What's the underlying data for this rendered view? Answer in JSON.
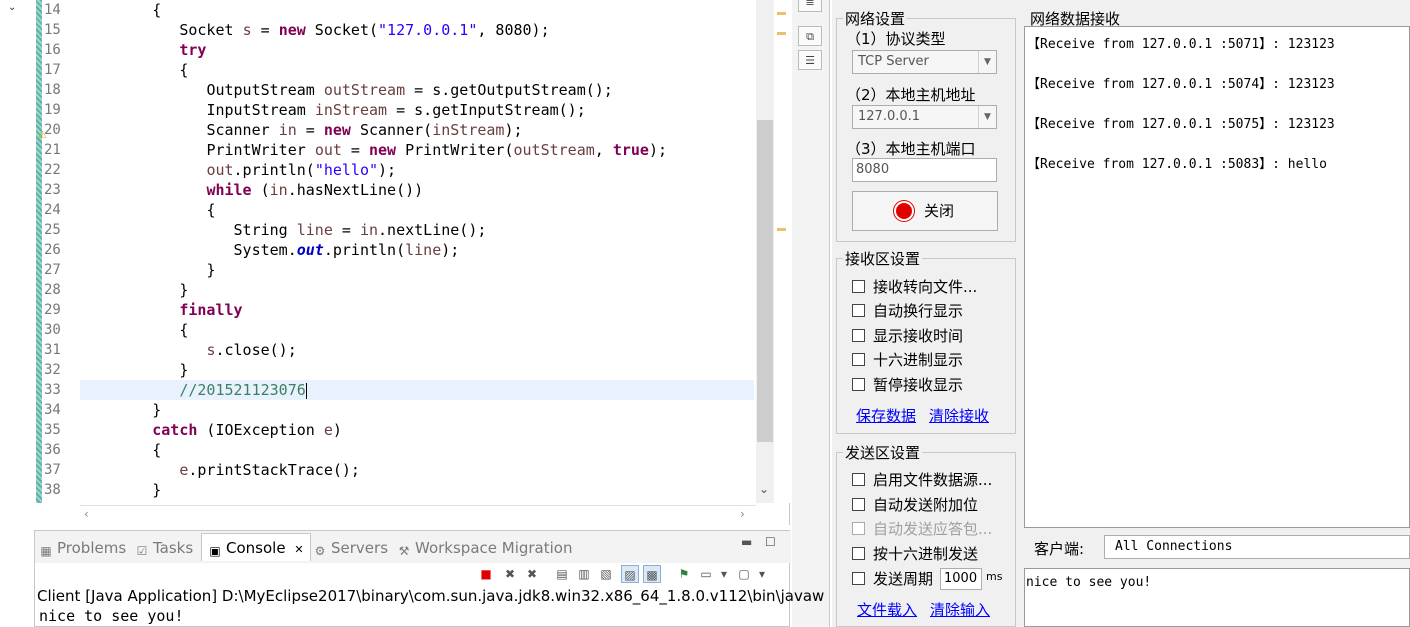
{
  "editor": {
    "line_numbers": [
      "14",
      "15",
      "16",
      "17",
      "18",
      "19",
      "20",
      "21",
      "22",
      "23",
      "24",
      "25",
      "26",
      "27",
      "28",
      "29",
      "30",
      "31",
      "32",
      "33",
      "34",
      "35",
      "36",
      "37",
      "38"
    ],
    "code": {
      "l14_brace": "{",
      "l15_type": "Socket ",
      "l15_var": "s",
      "l15_eq": " = ",
      "l15_kw": "new",
      "l15_call": " Socket(",
      "l15_str": "\"127.0.0.1\"",
      "l15_rest": ", 8080);",
      "l16_kw": "try",
      "l17_brace": "{",
      "l18_type": "OutputStream ",
      "l18_var": "outStream",
      "l18_rest": " = s.getOutputStream();",
      "l19_type": "InputStream ",
      "l19_var": "inStream",
      "l19_rest": " = s.getInputStream();",
      "l20_type": "Scanner ",
      "l20_var": "in",
      "l20_eq": " = ",
      "l20_kw": "new",
      "l20_call": " Scanner(",
      "l20_arg": "inStream",
      "l20_rest": ");",
      "l21_type": "PrintWriter ",
      "l21_var": "out",
      "l21_eq": " = ",
      "l21_kw": "new",
      "l21_call": " PrintWriter(",
      "l21_arg": "outStream",
      "l21_sep": ", ",
      "l21_kw2": "true",
      "l21_rest": ");",
      "l22_var": "out",
      "l22_call": ".println(",
      "l22_str": "\"hello\"",
      "l22_rest": ");",
      "l23_kw": "while",
      "l23_open": " (",
      "l23_var": "in",
      "l23_rest": ".hasNextLine())",
      "l24_brace": "{",
      "l25_type": "String ",
      "l25_var": "line",
      "l25_eq": " = ",
      "l25_var2": "in",
      "l25_rest": ".nextLine();",
      "l26_cls": "System.",
      "l26_fld": "out",
      "l26_call": ".println(",
      "l26_var": "line",
      "l26_rest": ");",
      "l27_brace": "}",
      "l28_brace": "}",
      "l29_kw": "finally",
      "l30_brace": "{",
      "l31_var": "s",
      "l31_rest": ".close();",
      "l32_brace": "}",
      "l33_cmt": "//201521123076",
      "l34_brace": "}",
      "l35_kw": "catch",
      "l35_open": " (IOException ",
      "l35_var": "e",
      "l35_rest": ")",
      "l36_brace": "{",
      "l37_var": "e",
      "l37_rest": ".printStackTrace();",
      "l38_brace": "}"
    }
  },
  "console_view": {
    "tabs": [
      {
        "label": "Problems",
        "icon": "problems-icon"
      },
      {
        "label": "Tasks",
        "icon": "tasks-icon"
      },
      {
        "label": "Console",
        "icon": "console-icon",
        "close": "✕"
      },
      {
        "label": "Servers",
        "icon": "servers-icon"
      },
      {
        "label": "Workspace Migration",
        "icon": "migration-icon"
      }
    ],
    "description": "Client [Java Application] D:\\MyEclipse2017\\binary\\com.sun.java.jdk8.win32.x86_64_1.8.0.v112\\bin\\javaw",
    "output": "nice to see you!"
  },
  "tool": {
    "network_settings": {
      "title": "网络设置",
      "protocol_label": "（1）协议类型",
      "protocol_value": "TCP Server",
      "host_label": "（2）本地主机地址",
      "host_value": "127.0.0.1",
      "port_label": "（3）本地主机端口",
      "port_value": "8080",
      "close_button": "关闭"
    },
    "receive_settings": {
      "title": "接收区设置",
      "options": [
        "接收转向文件...",
        "自动换行显示",
        "显示接收时间",
        "十六进制显示",
        "暂停接收显示"
      ],
      "save_link": "保存数据",
      "clear_link": "清除接收"
    },
    "send_settings": {
      "title": "发送区设置",
      "options": [
        "启用文件数据源...",
        "自动发送附加位",
        "自动发送应答包...",
        "按十六进制发送",
        "发送周期"
      ],
      "period_value": "1000",
      "period_unit": "ms",
      "load_link": "文件载入",
      "clear_link": "清除输入"
    },
    "receive_area": {
      "title": "网络数据接收",
      "lines": [
        "【Receive from 127.0.0.1 :5071】: 123123",
        "【Receive from 127.0.0.1 :5074】: 123123",
        "【Receive from 127.0.0.1 :5075】: 123123",
        "【Receive from 127.0.0.1 :5083】: hello"
      ]
    },
    "client_label": "客户端:",
    "client_value": "All Connections",
    "send_text": "nice to see you!"
  },
  "colors": {
    "keyword": "#7f0055",
    "string": "#2a00ff",
    "comment": "#3f7f5f",
    "link": "#0000ff",
    "close_led": "#e00000"
  }
}
